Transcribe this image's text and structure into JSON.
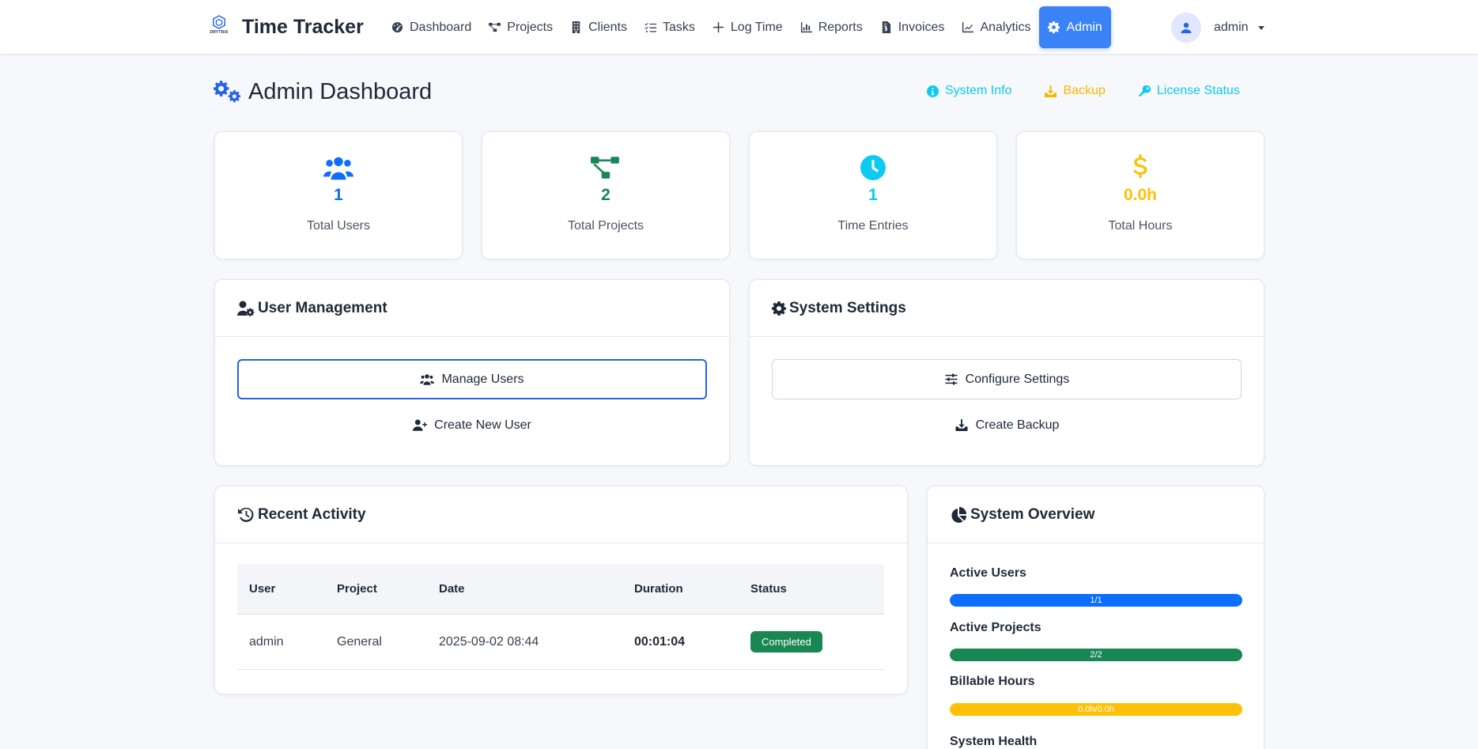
{
  "navbar": {
    "logo_text": "DRYTRIX",
    "brand": "Time Tracker",
    "items": [
      {
        "label": "Dashboard",
        "icon": "dashboard-icon"
      },
      {
        "label": "Projects",
        "icon": "project-diagram-icon"
      },
      {
        "label": "Clients",
        "icon": "building-icon"
      },
      {
        "label": "Tasks",
        "icon": "tasks-icon"
      },
      {
        "label": "Log Time",
        "icon": "plus-icon"
      },
      {
        "label": "Reports",
        "icon": "chart-bar-icon"
      },
      {
        "label": "Invoices",
        "icon": "invoice-icon"
      },
      {
        "label": "Analytics",
        "icon": "chart-line-icon"
      },
      {
        "label": "Admin",
        "icon": "gear-icon",
        "active": true
      }
    ],
    "user": "admin"
  },
  "header": {
    "title": "Admin Dashboard",
    "links": {
      "system_info": "System Info",
      "backup": "Backup",
      "license_status": "License Status"
    }
  },
  "stats": [
    {
      "value": "1",
      "label": "Total Users",
      "color": "#0d6efd",
      "icon": "users-icon"
    },
    {
      "value": "2",
      "label": "Total Projects",
      "color": "#198754",
      "icon": "project-diagram-icon"
    },
    {
      "value": "1",
      "label": "Time Entries",
      "color": "#0dcaf0",
      "icon": "clock-icon"
    },
    {
      "value": "0.0h",
      "label": "Total Hours",
      "color": "#ffc107",
      "icon": "dollar-icon"
    }
  ],
  "user_management": {
    "title": "User Management",
    "manage_users": "Manage Users",
    "create_user": "Create New User"
  },
  "system_settings": {
    "title": "System Settings",
    "configure": "Configure Settings",
    "create_backup": "Create Backup"
  },
  "recent_activity": {
    "title": "Recent Activity",
    "columns": [
      "User",
      "Project",
      "Date",
      "Duration",
      "Status"
    ],
    "rows": [
      {
        "user": "admin",
        "project": "General",
        "date": "2025-09-02 08:44",
        "duration": "00:01:04",
        "status": "Completed"
      }
    ]
  },
  "system_overview": {
    "title": "System Overview",
    "items": [
      {
        "label": "Active Users",
        "text": "1/1",
        "fraction": 1.0,
        "color": "#0d6efd"
      },
      {
        "label": "Active Projects",
        "text": "2/2",
        "fraction": 1.0,
        "color": "#198754"
      },
      {
        "label": "Billable Hours",
        "text": "0.0h/0.0h",
        "fraction": 1.0,
        "color": "#ffc107"
      }
    ],
    "health_label": "System Health"
  }
}
